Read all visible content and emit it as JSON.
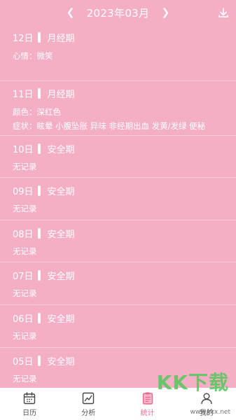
{
  "header": {
    "month_title": "2023年03月",
    "prev_icon": "chevron-left-icon",
    "next_icon": "chevron-right-icon",
    "download_icon": "download-icon"
  },
  "entries": [
    {
      "day": "12日",
      "phase": "月经期",
      "lines": [
        "心情：微笑"
      ]
    },
    {
      "day": "11日",
      "phase": "月经期",
      "lines": [
        "颜色：深红色",
        "症状：眩晕 小腹坠胀 异味 非经期出血 发黄/发绿 便秘"
      ]
    },
    {
      "day": "10日",
      "phase": "安全期",
      "lines": [
        "无记录"
      ]
    },
    {
      "day": "09日",
      "phase": "安全期",
      "lines": [
        "无记录"
      ]
    },
    {
      "day": "08日",
      "phase": "安全期",
      "lines": [
        "无记录"
      ]
    },
    {
      "day": "07日",
      "phase": "安全期",
      "lines": [
        "无记录"
      ]
    },
    {
      "day": "06日",
      "phase": "安全期",
      "lines": [
        "无记录"
      ]
    },
    {
      "day": "05日",
      "phase": "安全期",
      "lines": [
        "无记录"
      ]
    }
  ],
  "tabs": [
    {
      "label": "日历",
      "icon": "calendar-icon",
      "active": false
    },
    {
      "label": "分析",
      "icon": "chart-icon",
      "active": false
    },
    {
      "label": "统计",
      "icon": "clipboard-icon",
      "active": true
    },
    {
      "label": "我的",
      "icon": "user-icon",
      "active": false
    }
  ],
  "watermark": {
    "brand": "KK下载",
    "url": "www.kkx.net"
  },
  "colors": {
    "background": "#F4AFC5",
    "accent": "#E86A8E",
    "tabbar": "#FFFFFF"
  }
}
